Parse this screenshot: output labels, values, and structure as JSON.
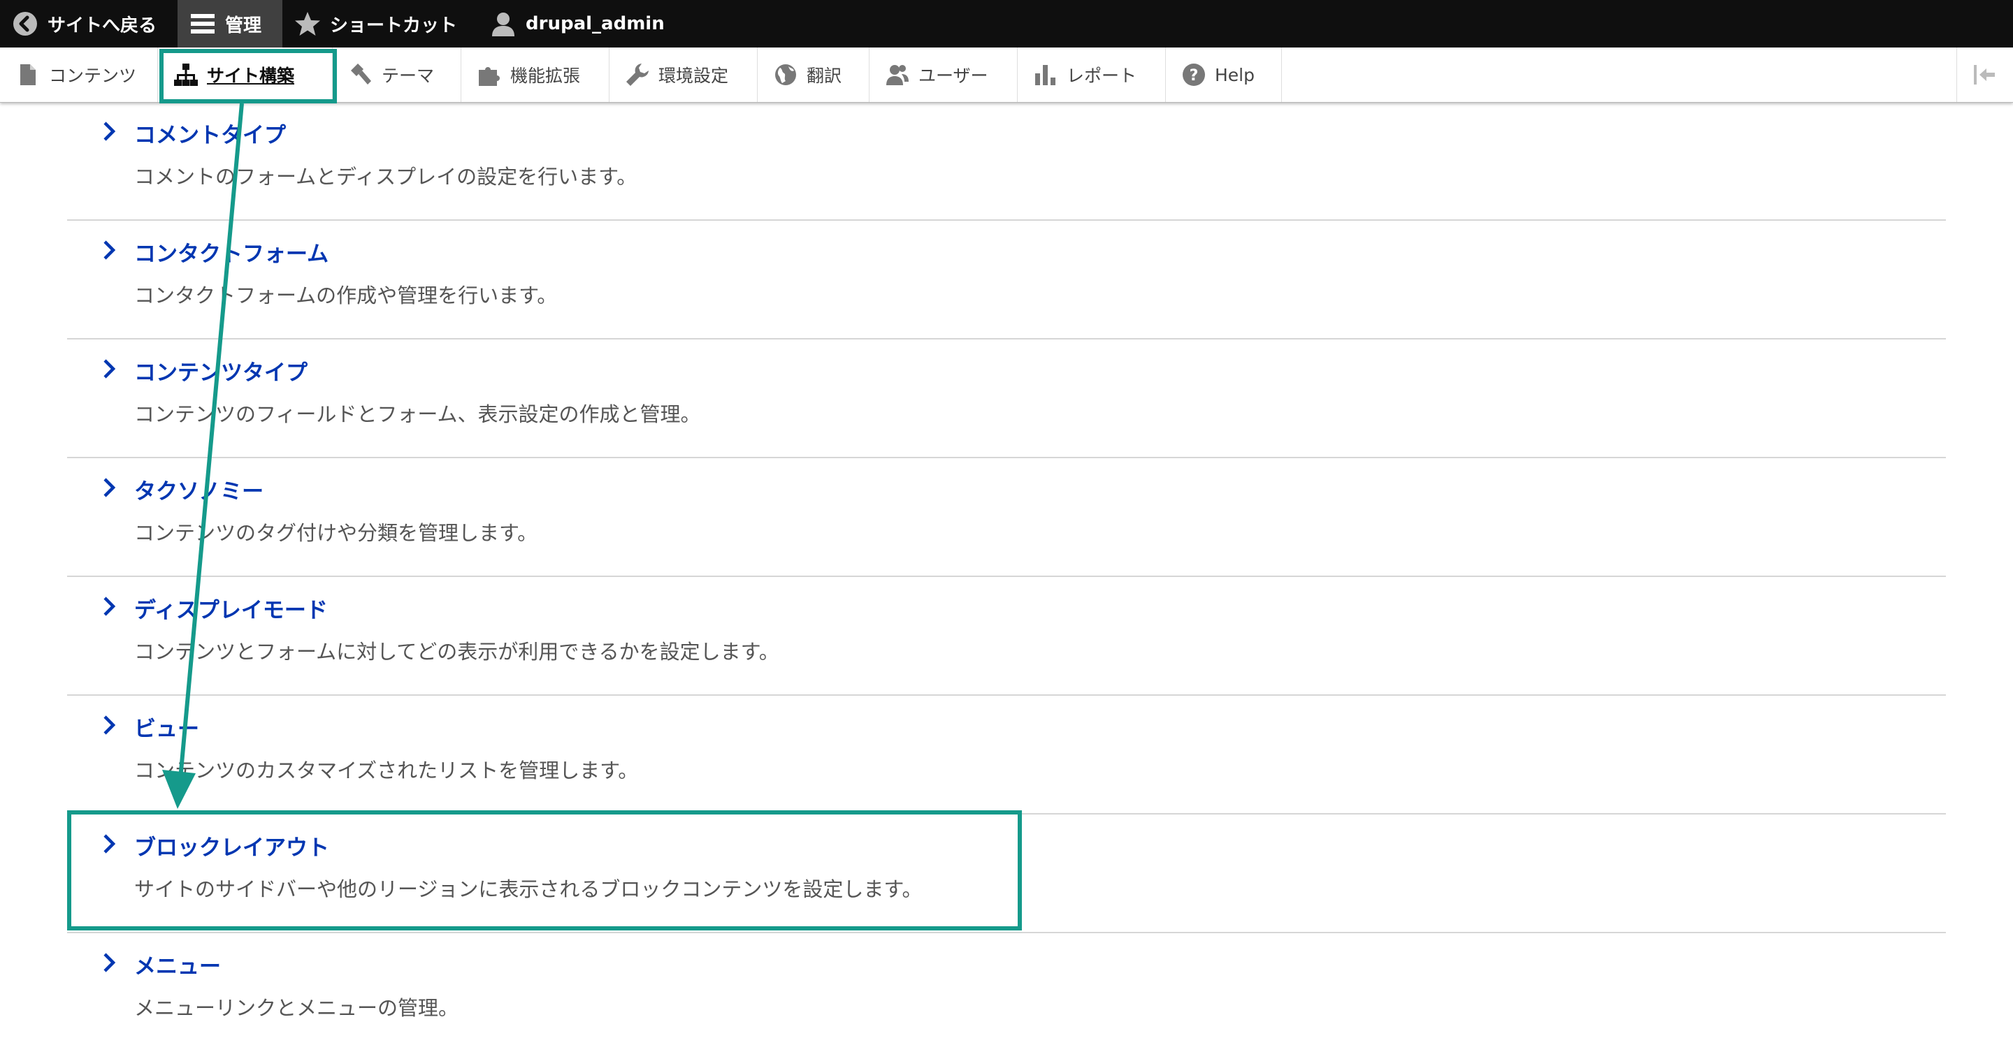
{
  "toolbar": {
    "back_label": "サイトへ戻る",
    "manage_label": "管理",
    "shortcuts_label": "ショートカット",
    "user_label": "drupal_admin"
  },
  "tray": {
    "tabs": [
      {
        "label": "コンテンツ",
        "icon": "page-icon"
      },
      {
        "label": "サイト構築",
        "icon": "sitemap-icon",
        "active": true
      },
      {
        "label": "テーマ",
        "icon": "brush-icon"
      },
      {
        "label": "機能拡張",
        "icon": "puzzle-icon"
      },
      {
        "label": "環境設定",
        "icon": "wrench-icon"
      },
      {
        "label": "翻訳",
        "icon": "globe-icon"
      },
      {
        "label": "ユーザー",
        "icon": "people-icon"
      },
      {
        "label": "レポート",
        "icon": "bar-chart-icon"
      },
      {
        "label": "Help",
        "icon": "question-icon"
      }
    ]
  },
  "items": [
    {
      "title": "コメントタイプ",
      "desc": "コメントのフォームとディスプレイの設定を行います。"
    },
    {
      "title": "コンタクトフォーム",
      "desc": "コンタクトフォームの作成や管理を行います。"
    },
    {
      "title": "コンテンツタイプ",
      "desc": "コンテンツのフィールドとフォーム、表示設定の作成と管理。"
    },
    {
      "title": "タクソノミー",
      "desc": "コンテンツのタグ付けや分類を管理します。"
    },
    {
      "title": "ディスプレイモード",
      "desc": "コンテンツとフォームに対してどの表示が利用できるかを設定します。"
    },
    {
      "title": "ビュー",
      "desc": "コンテンツのカスタマイズされたリストを管理します。"
    },
    {
      "title": "ブロックレイアウト",
      "desc": "サイトのサイドバーや他のリージョンに表示されるブロックコンテンツを設定します。"
    },
    {
      "title": "メニュー",
      "desc": "メニューリンクとメニューの管理。"
    }
  ],
  "colors": {
    "link": "#0036b1",
    "highlight": "#159a8b",
    "toolbar_bg": "#0f0f0f"
  }
}
